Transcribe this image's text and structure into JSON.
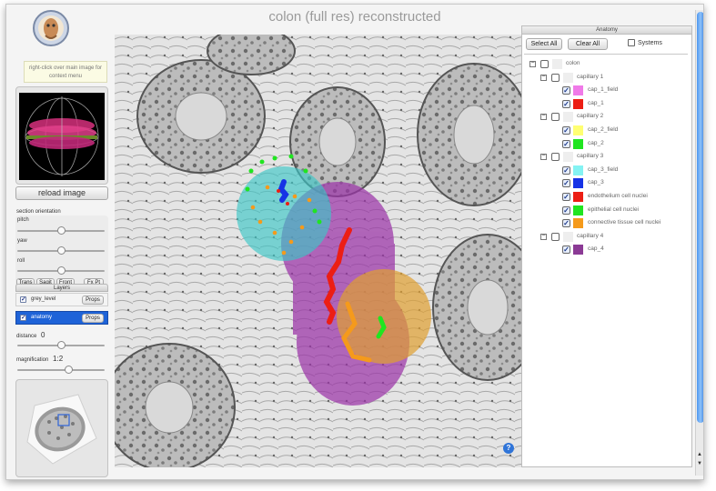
{
  "window": {
    "title": "colon (full res) reconstructed"
  },
  "hint": {
    "text": "right-click over main image for context menu"
  },
  "left": {
    "reload_label": "reload image",
    "orientation_label": "section orientation",
    "pitch_label": "pitch",
    "yaw_label": "yaw",
    "roll_label": "roll",
    "pitch_value": 0.5,
    "yaw_value": 0.5,
    "roll_value": 0.5,
    "view_buttons": [
      "Trans",
      "Sagit",
      "Front",
      "Fx Pt"
    ],
    "layers_title": "Layers",
    "layers": [
      {
        "name": "grey_level",
        "checked": true,
        "props": "Props",
        "selected": false
      },
      {
        "name": "anatomy",
        "checked": true,
        "props": "Props",
        "selected": true
      }
    ],
    "distance_label": "distance",
    "distance_value": "0",
    "distance_level": 0.5,
    "magnification_label": "magnification",
    "magnification_value": "1:2",
    "magnification_level": 0.6
  },
  "anatomy": {
    "panel_title": "Anatomy",
    "select_all": "Select All",
    "clear_all": "Clear All",
    "systems_label": "Systems",
    "systems_checked": false,
    "tree": [
      {
        "label": "colon",
        "level": 0,
        "type": "group",
        "expanded": true
      },
      {
        "label": "capillary 1",
        "level": 1,
        "type": "group",
        "expanded": true
      },
      {
        "label": "cap_1_field",
        "level": 2,
        "type": "leaf",
        "color": "#f07ae8",
        "checked": true
      },
      {
        "label": "cap_1",
        "level": 2,
        "type": "leaf",
        "color": "#ec1e14",
        "checked": true
      },
      {
        "label": "capillary 2",
        "level": 1,
        "type": "group",
        "expanded": true
      },
      {
        "label": "cap_2_field",
        "level": 2,
        "type": "leaf",
        "color": "#ffff72",
        "checked": true
      },
      {
        "label": "cap_2",
        "level": 2,
        "type": "leaf",
        "color": "#20e520",
        "checked": true
      },
      {
        "label": "capillary 3",
        "level": 1,
        "type": "group",
        "expanded": true
      },
      {
        "label": "cap_3_field",
        "level": 2,
        "type": "leaf",
        "color": "#84f3f3",
        "checked": true
      },
      {
        "label": "cap_3",
        "level": 2,
        "type": "leaf",
        "color": "#1633e6",
        "checked": true
      },
      {
        "label": "endothelium cell nuclei",
        "level": 2,
        "type": "leaf",
        "color": "#ec1e14",
        "checked": true
      },
      {
        "label": "epithelial cell nuclei",
        "level": 2,
        "type": "leaf",
        "color": "#20e520",
        "checked": true
      },
      {
        "label": "connective tissue cell nuclei",
        "level": 2,
        "type": "leaf",
        "color": "#f59a1b",
        "checked": true
      },
      {
        "label": "capillary 4",
        "level": 1,
        "type": "group",
        "expanded": true
      },
      {
        "label": "cap_4",
        "level": 2,
        "type": "leaf",
        "color": "#8b3a95",
        "checked": true
      }
    ]
  },
  "colors": {
    "accent": "#1e63d8",
    "cap3_field": "#3cc6c6",
    "cap4": "#9b34a8",
    "cap2_field": "#e0a030"
  },
  "help": {
    "label": "?"
  }
}
